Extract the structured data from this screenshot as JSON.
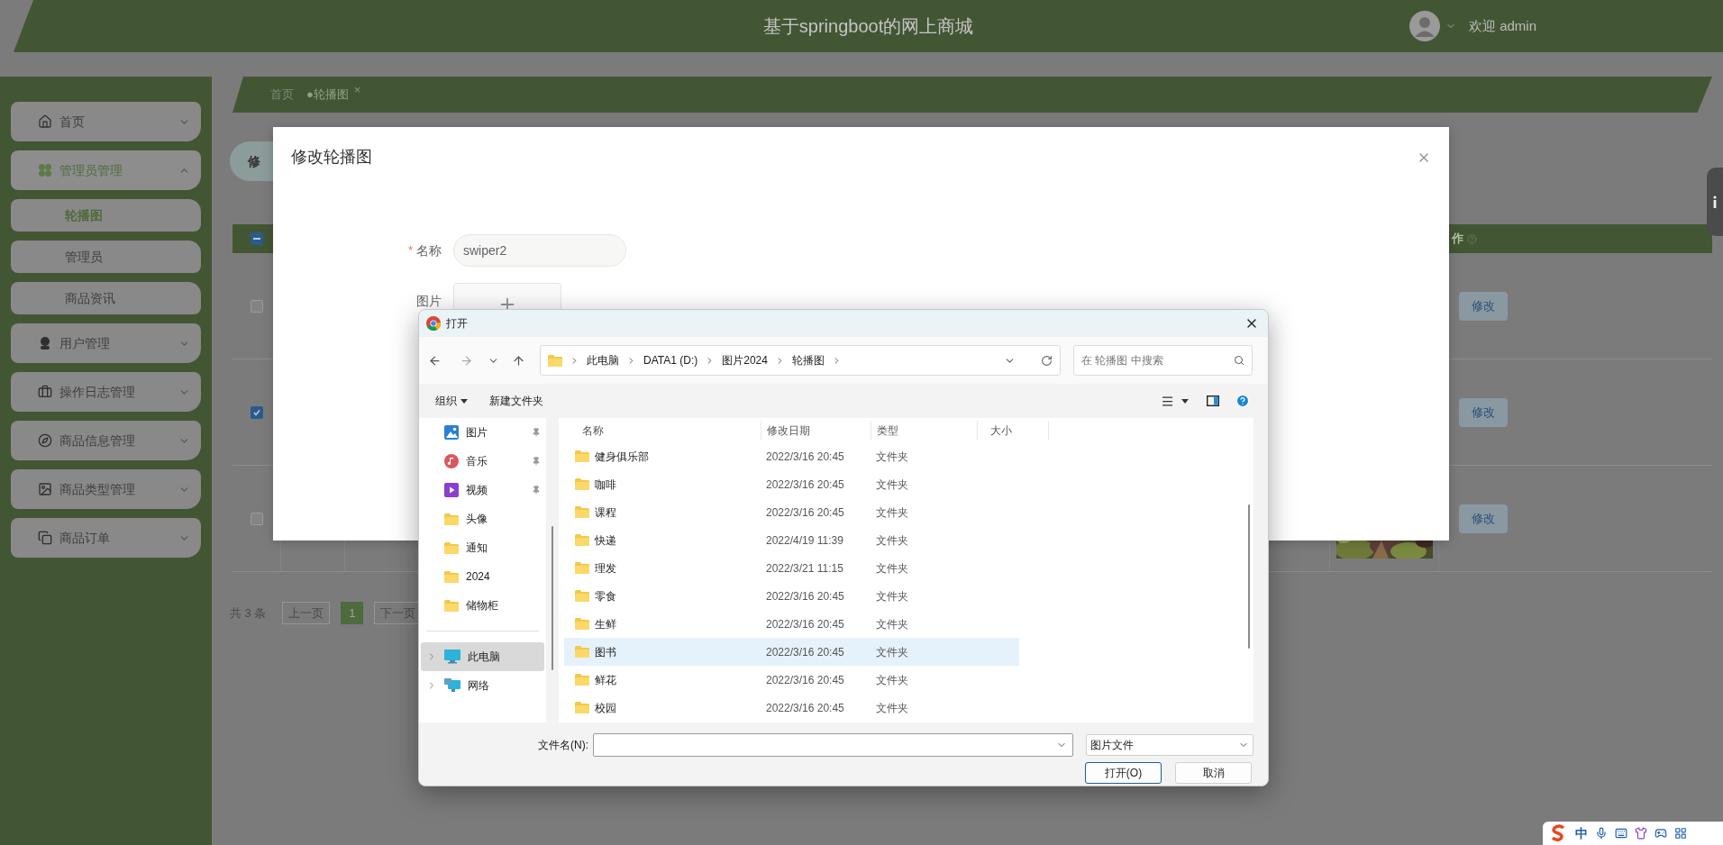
{
  "header": {
    "title": "基于springboot的网上商城",
    "user": "欢迎 admin"
  },
  "sidebar": {
    "items": [
      {
        "label": "首页",
        "expanded": false
      },
      {
        "label": "管理员管理",
        "expanded": true,
        "children": [
          {
            "label": "轮播图",
            "selected": true
          },
          {
            "label": "管理员",
            "selected": false
          },
          {
            "label": "商品资讯",
            "selected": false
          }
        ]
      },
      {
        "label": "用户管理",
        "expanded": false
      },
      {
        "label": "操作日志管理",
        "expanded": false
      },
      {
        "label": "商品信息管理",
        "expanded": false
      },
      {
        "label": "商品类型管理",
        "expanded": false
      },
      {
        "label": "商品订单",
        "expanded": false
      }
    ]
  },
  "breadcrumb": [
    {
      "label": "首页",
      "selected": false
    },
    {
      "label": "●轮播图",
      "selected": true,
      "close": "×"
    }
  ],
  "toolbar_button": "修",
  "table": {
    "select_all": {
      "indeterminate": true
    },
    "action_column": "作",
    "rows": [
      {
        "checked": false,
        "action": "修改"
      },
      {
        "checked": true,
        "action": "修改"
      },
      {
        "checked": false,
        "action": "修改"
      }
    ]
  },
  "pagination": {
    "total": "共 3 条",
    "prev": "上一页",
    "pages": [
      {
        "label": "1",
        "selected": true
      }
    ],
    "next": "下一页"
  },
  "modal": {
    "title": "修改轮播图",
    "fields": [
      {
        "kind": "text",
        "label": "名称",
        "required_mark": "*",
        "value": "swiper2"
      },
      {
        "kind": "upload",
        "label": "图片"
      }
    ]
  },
  "file_dialog": {
    "title": "打开",
    "path": [
      "此电脑",
      "DATA1 (D:)",
      "图片2024",
      "轮播图"
    ],
    "search_placeholder": "在 轮播图 中搜索",
    "organize": "组织",
    "new_folder": "新建文件夹",
    "quick_access": [
      {
        "kind": "pictures",
        "label": "图片",
        "pinned": true
      },
      {
        "kind": "music",
        "label": "音乐",
        "pinned": true
      },
      {
        "kind": "videos",
        "label": "视频",
        "pinned": true
      },
      {
        "kind": "folder",
        "label": "头像",
        "pinned": false
      },
      {
        "kind": "folder",
        "label": "通知",
        "pinned": false
      },
      {
        "kind": "folder",
        "label": "2024",
        "pinned": false
      },
      {
        "kind": "folder",
        "label": "储物柜",
        "pinned": false
      }
    ],
    "locations": [
      {
        "kind": "pc",
        "label": "此电脑",
        "selected": true
      },
      {
        "kind": "network",
        "label": "网络",
        "selected": false
      }
    ],
    "columns": [
      "名称",
      "修改日期",
      "类型",
      "大小"
    ],
    "files": [
      {
        "name": "健身俱乐部",
        "date": "2022/3/16 20:45",
        "type": "文件夹",
        "selected": false
      },
      {
        "name": "咖啡",
        "date": "2022/3/16 20:45",
        "type": "文件夹",
        "selected": false
      },
      {
        "name": "课程",
        "date": "2022/3/16 20:45",
        "type": "文件夹",
        "selected": false
      },
      {
        "name": "快递",
        "date": "2022/4/19 11:39",
        "type": "文件夹",
        "selected": false
      },
      {
        "name": "理发",
        "date": "2022/3/21 11:15",
        "type": "文件夹",
        "selected": false
      },
      {
        "name": "零食",
        "date": "2022/3/16 20:45",
        "type": "文件夹",
        "selected": false
      },
      {
        "name": "生鲜",
        "date": "2022/3/16 20:45",
        "type": "文件夹",
        "selected": false
      },
      {
        "name": "图书",
        "date": "2022/3/16 20:45",
        "type": "文件夹",
        "selected": true
      },
      {
        "name": "鲜花",
        "date": "2022/3/16 20:45",
        "type": "文件夹",
        "selected": false
      },
      {
        "name": "校园",
        "date": "2022/3/16 20:45",
        "type": "文件夹",
        "selected": false
      }
    ],
    "filename_label": "文件名(N):",
    "filter": "图片文件",
    "open": "打开(O)",
    "cancel": "取消"
  },
  "ime": {
    "mode": "中"
  }
}
